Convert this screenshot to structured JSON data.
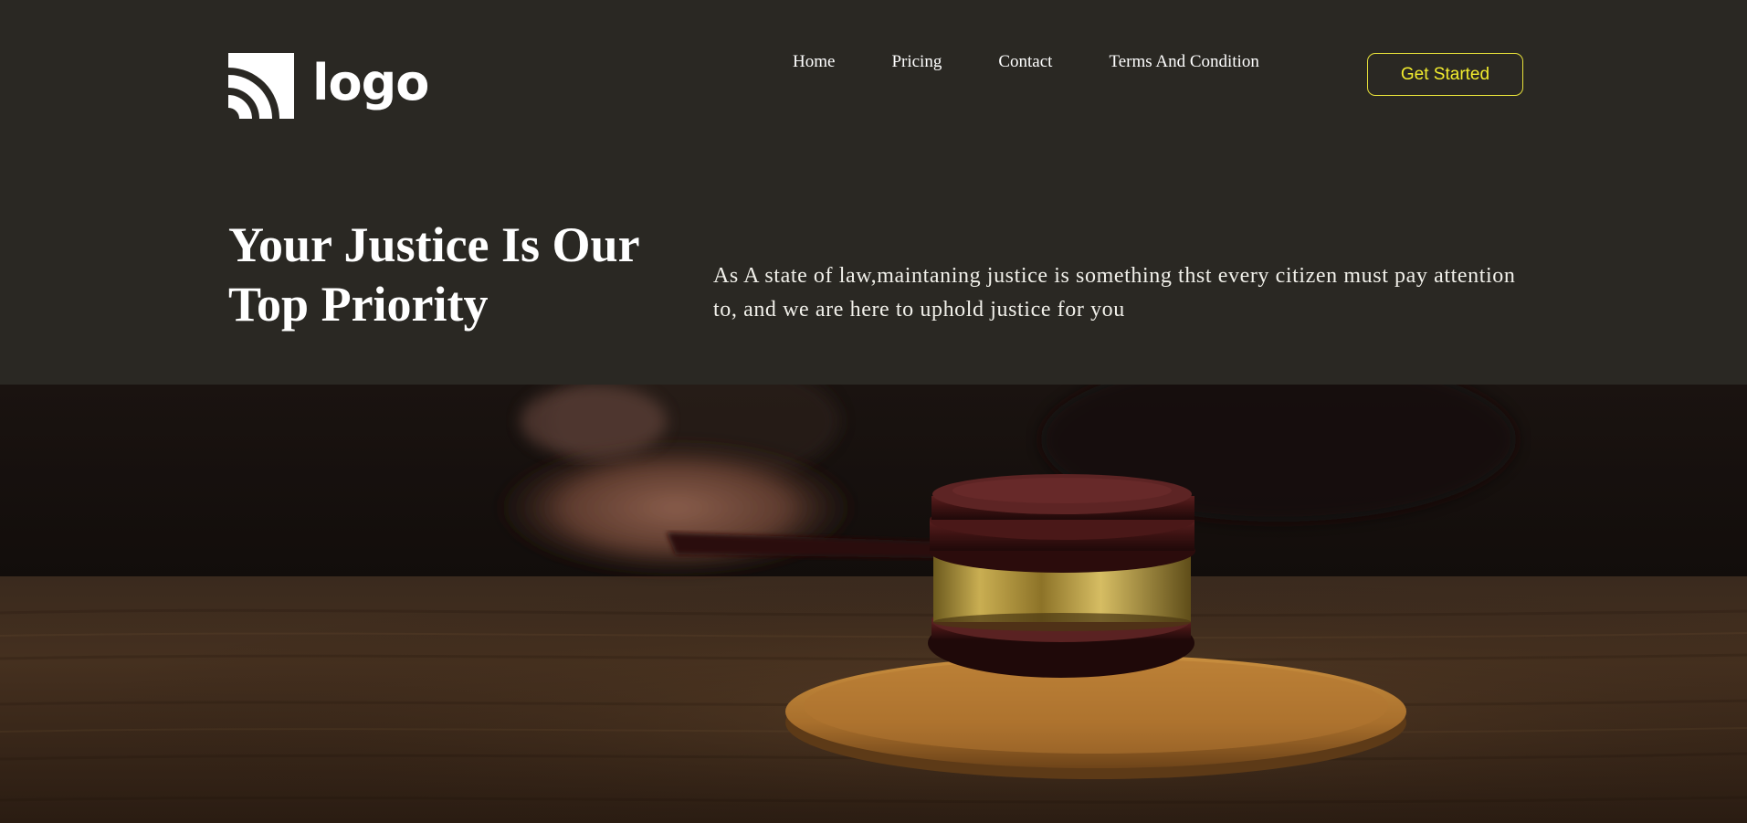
{
  "brand": {
    "logo_text": "logo",
    "logo_icon": "logo-arcs-icon"
  },
  "nav": {
    "items": [
      {
        "label": "Home"
      },
      {
        "label": "Pricing"
      },
      {
        "label": "Contact"
      },
      {
        "label": "Terms And Condition"
      }
    ]
  },
  "cta": {
    "label": "Get Started"
  },
  "hero": {
    "title": "Your Justice Is Our Top Priority",
    "description": "As A state of law,maintaning justice is something thst every citizen must pay attention to, and we are here to uphold justice for you"
  },
  "colors": {
    "background": "#2a2823",
    "accent": "#f2ec2e",
    "text": "#ffffff"
  }
}
